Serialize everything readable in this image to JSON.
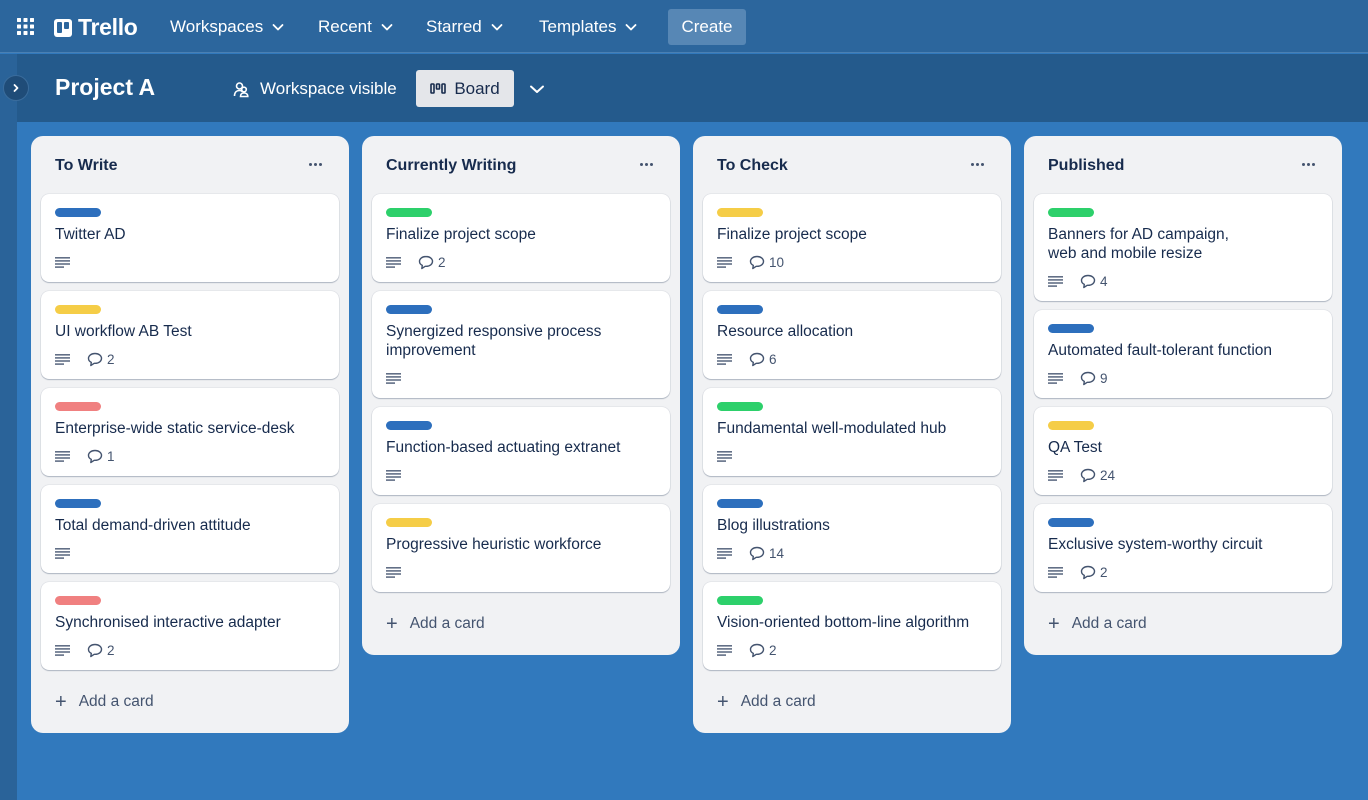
{
  "app": {
    "brand": "Trello",
    "nav": {
      "workspaces": "Workspaces",
      "recent": "Recent",
      "starred": "Starred",
      "templates": "Templates",
      "create": "Create"
    }
  },
  "board": {
    "title": "Project A",
    "visibility": "Workspace visible",
    "view": "Board"
  },
  "colors": {
    "label_blue": "#2d6fbd",
    "label_yellow": "#f5cd47",
    "label_red": "#f08080",
    "label_green": "#2dd06b",
    "board_bg": "#3179bd",
    "nav_bg": "#2c669d",
    "header_bg": "#245a8c"
  },
  "lists": [
    {
      "title": "To Write",
      "add_label": "Add a card",
      "cards": [
        {
          "label": "blue",
          "title": "Twitter AD",
          "description": true,
          "comments": null
        },
        {
          "label": "yellow",
          "title": "UI workflow AB Test",
          "description": true,
          "comments": "2"
        },
        {
          "label": "red",
          "title": "Enterprise-wide static service-desk",
          "description": true,
          "comments": "1"
        },
        {
          "label": "blue",
          "title": "Total demand-driven attitude",
          "description": true,
          "comments": null
        },
        {
          "label": "red",
          "title": "Synchronised interactive adapter",
          "description": true,
          "comments": "2"
        }
      ]
    },
    {
      "title": "Currently Writing",
      "add_label": "Add a card",
      "cards": [
        {
          "label": "green",
          "title": "Finalize project scope",
          "description": true,
          "comments": "2"
        },
        {
          "label": "blue",
          "title": "Synergized responsive process improvement",
          "description": true,
          "comments": null
        },
        {
          "label": "blue",
          "title": "Function-based actuating extranet",
          "description": true,
          "comments": null
        },
        {
          "label": "yellow",
          "title": "Progressive heuristic workforce",
          "description": true,
          "comments": null
        }
      ]
    },
    {
      "title": "To Check",
      "add_label": "Add a card",
      "cards": [
        {
          "label": "yellow",
          "title": "Finalize project scope",
          "description": true,
          "comments": "10"
        },
        {
          "label": "blue",
          "title": "Resource allocation",
          "description": true,
          "comments": "6"
        },
        {
          "label": "green",
          "title": "Fundamental well-modulated hub",
          "description": true,
          "comments": null
        },
        {
          "label": "blue",
          "title": "Blog illustrations",
          "description": true,
          "comments": "14"
        },
        {
          "label": "green",
          "title": "Vision-oriented bottom-line algorithm",
          "description": true,
          "comments": "2"
        }
      ]
    },
    {
      "title": "Published",
      "add_label": "Add a card",
      "cards": [
        {
          "label": "green",
          "title": "Banners for AD campaign, web and mobile resize",
          "description": true,
          "comments": "4"
        },
        {
          "label": "blue",
          "title": "Automated fault-tolerant function",
          "description": true,
          "comments": "9"
        },
        {
          "label": "yellow",
          "title": "QA Test",
          "description": true,
          "comments": "24"
        },
        {
          "label": "blue",
          "title": "Exclusive system-worthy circuit",
          "description": true,
          "comments": "2"
        }
      ]
    }
  ]
}
